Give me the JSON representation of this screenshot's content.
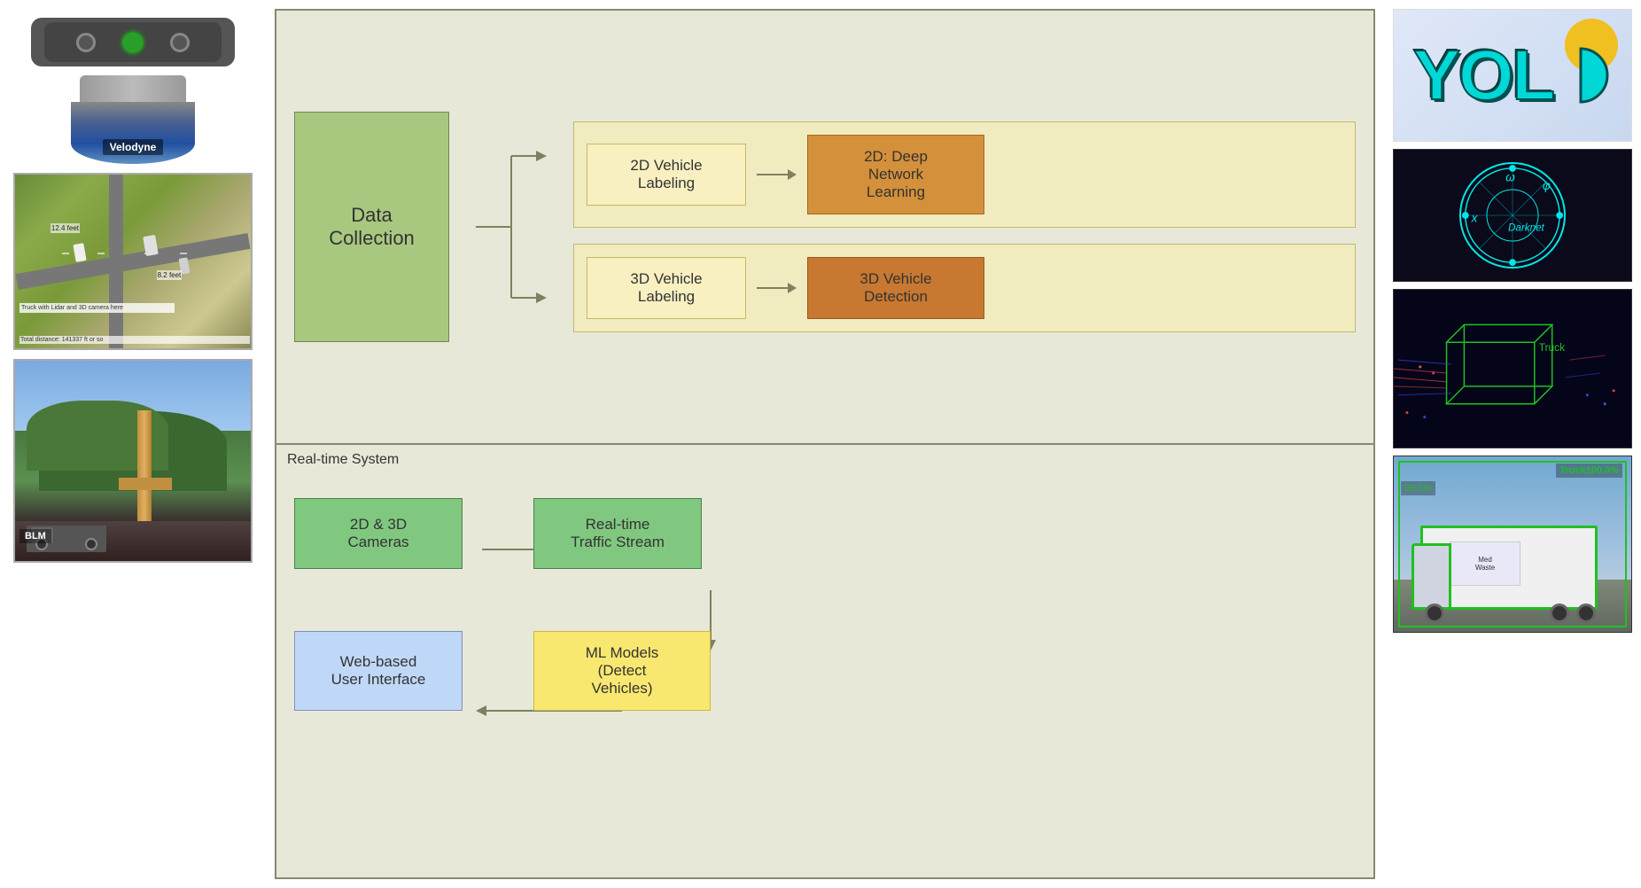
{
  "left_panel": {
    "camera_label": "Stereo Camera",
    "lidar_label": "Velodyne",
    "aerial_caption": "Truck with Lidar and 3D camera here",
    "field_caption": "BLM"
  },
  "top_diagram": {
    "section_label": "",
    "data_collection": "Data\nCollection",
    "box1_label": "2D Vehicle\nLabeling",
    "box2_label": "2D: Deep\nNetwork\nLearning",
    "box3_label": "3D Vehicle\nLabeling",
    "box4_label": "3D Vehicle\nDetection"
  },
  "bottom_diagram": {
    "section_label": "Real-time System",
    "cameras_label": "2D & 3D\nCameras",
    "stream_label": "Real-time\nTraffic Stream",
    "ml_label": "ML Models\n(Detect\nVehicles)",
    "ui_label": "Web-based\nUser Interface"
  },
  "right_panel": {
    "yolo_text": "YOL",
    "darknet_label": "Darknet",
    "truck_label": "Truck",
    "detection_label1": "Truck100.0%",
    "detection_label2": "99.0%"
  }
}
